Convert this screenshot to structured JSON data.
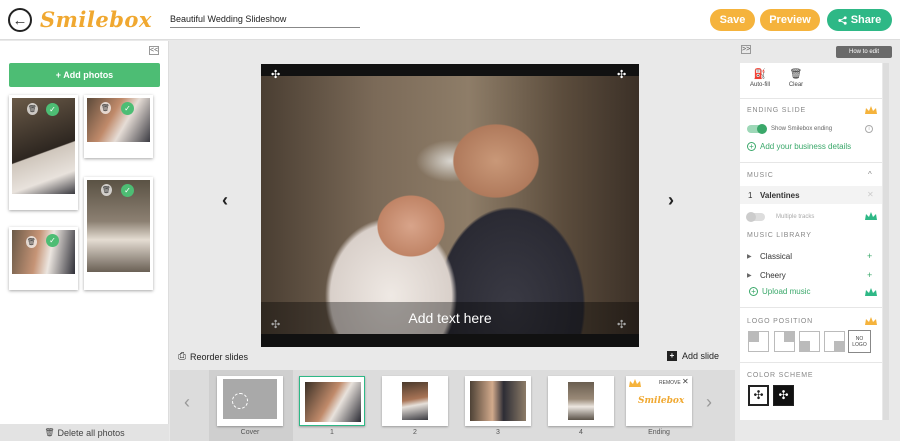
{
  "header": {
    "brand": "Smilebox",
    "project_title": "Beautiful Wedding Slideshow",
    "save_label": "Save",
    "preview_label": "Preview",
    "share_label": "Share"
  },
  "left_panel": {
    "add_photos_label": "+ Add photos",
    "delete_all_label": "Delete all photos",
    "collapse_glyph": "<<"
  },
  "canvas": {
    "caption": "Add text here",
    "reorder_label": "Reorder slides",
    "add_slide_label": "Add slide"
  },
  "filmstrip": {
    "slides": [
      {
        "label": "Cover"
      },
      {
        "label": "1"
      },
      {
        "label": "2"
      },
      {
        "label": "3"
      },
      {
        "label": "4"
      },
      {
        "label": "Ending"
      }
    ],
    "ending_remove": "REMOVE",
    "ending_brand": "Smilebox"
  },
  "right_panel": {
    "how_to_edit": "How to edit",
    "expand_glyph": ">>",
    "autofill_label": "Auto-fill",
    "clear_label": "Clear",
    "ending_slide_title": "ENDING SLIDE",
    "show_ending_label": "Show Smilebox ending",
    "add_business_label": "Add your business details",
    "music_title": "MUSIC",
    "music_track_num": "1",
    "music_track_name": "Valentines",
    "multiple_tracks_label": "Multiple tracks",
    "music_library_title": "MUSIC LIBRARY",
    "library_items": [
      "Classical",
      "Cheery"
    ],
    "upload_music_label": "Upload music",
    "logo_position_title": "LOGO POSITION",
    "no_logo_label": "NO LOGO",
    "color_scheme_title": "COLOR SCHEME"
  },
  "colors": {
    "accent_orange": "#f5b33c",
    "accent_green": "#2eb886",
    "crown": "#f5b33c"
  }
}
